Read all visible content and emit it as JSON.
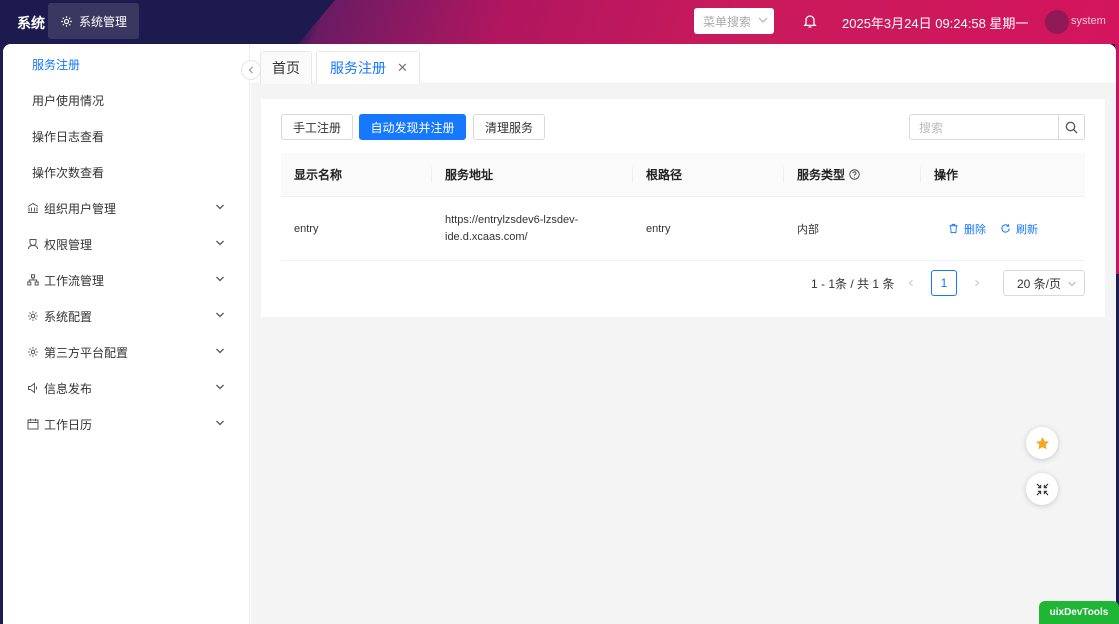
{
  "header": {
    "brand": "系统",
    "module_label": "系统管理",
    "menu_search_placeholder": "菜单搜索",
    "datetime": "2025年3月24日 09:24:58 星期一",
    "username": "system"
  },
  "sidebar": {
    "sub_items": [
      {
        "label": "服务注册",
        "active": true
      },
      {
        "label": "用户使用情况"
      },
      {
        "label": "操作日志查看"
      },
      {
        "label": "操作次数查看"
      }
    ],
    "groups": [
      {
        "label": "组织用户管理",
        "icon": "bank-icon"
      },
      {
        "label": "权限管理",
        "icon": "user-icon"
      },
      {
        "label": "工作流管理",
        "icon": "workflow-icon"
      },
      {
        "label": "系统配置",
        "icon": "gear-icon"
      },
      {
        "label": "第三方平台配置",
        "icon": "gear-icon"
      },
      {
        "label": "信息发布",
        "icon": "megaphone-icon"
      },
      {
        "label": "工作日历",
        "icon": "calendar-icon"
      }
    ]
  },
  "tabs": {
    "home": "首页",
    "active": "服务注册",
    "close": "✕"
  },
  "toolbar": {
    "manual_register": "手工注册",
    "auto_discover": "自动发现并注册",
    "clean_services": "清理服务",
    "search_placeholder": "搜索"
  },
  "table": {
    "headers": [
      "显示名称",
      "服务地址",
      "根路径",
      "服务类型",
      "操作"
    ],
    "rows": [
      {
        "name": "entry",
        "address_line1": "https://entrylzsdev6-lzsdev-",
        "address_line2": "ide.d.xcaas.com/",
        "root_path": "entry",
        "type": "内部",
        "actions": [
          "删除",
          "刷新"
        ]
      }
    ]
  },
  "pagination": {
    "summary": "1 - 1条 / 共 1 条",
    "current_page": "1",
    "page_size": "20 条/页"
  },
  "devtools_label": "uixDevTools",
  "colors": {
    "primary": "#1677ff",
    "topbar_dark": "#1d1a4f",
    "topbar_pink": "#c81a5c",
    "star": "#f5a623",
    "devtools": "#1fb636"
  }
}
